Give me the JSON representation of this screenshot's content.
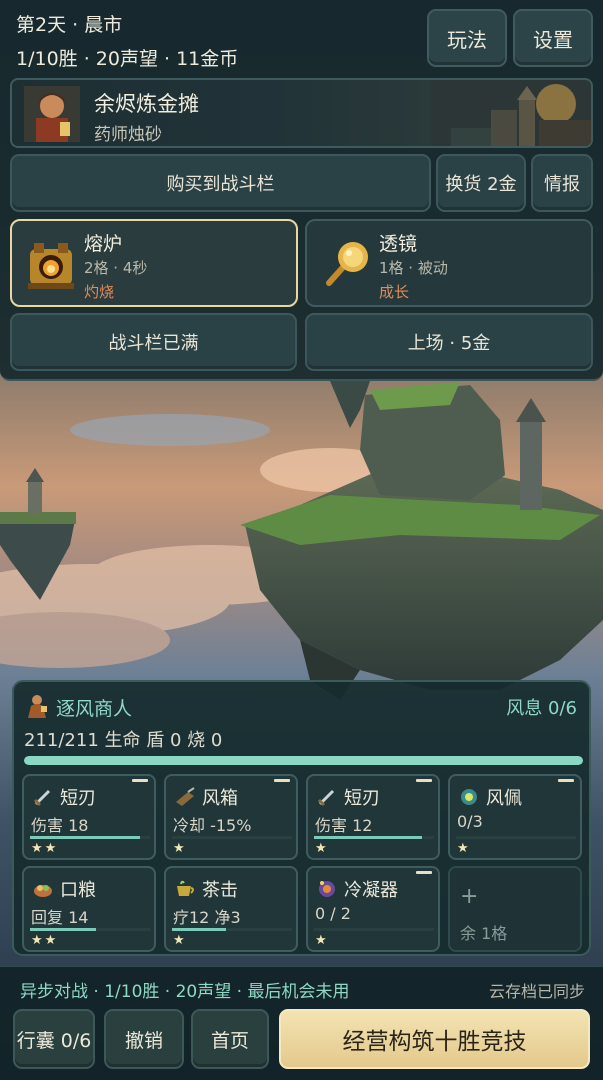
{
  "header": {
    "day_phase": "第2天 · 晨市",
    "progress": "1/10胜 · 20声望 · 11金币",
    "rules_label": "玩法",
    "settings_label": "设置"
  },
  "shop": {
    "name": "余烬炼金摊",
    "owner": "药师烛砂"
  },
  "actions": {
    "buy_label": "购买到战斗栏",
    "reroll_label": "换货 2金",
    "intel_label": "情报",
    "battle_full_label": "战斗栏已满",
    "deploy_label": "上场 · 5金"
  },
  "shop_items": [
    {
      "name": "熔炉",
      "stats": "2格 · 4秒",
      "tag": "灼烧",
      "icon": "furnace-icon",
      "selected": true
    },
    {
      "name": "透镜",
      "stats": "1格 · 被动",
      "tag": "成长",
      "icon": "lens-icon",
      "selected": false
    }
  ],
  "opponent": {
    "name": "逐风商人",
    "wind": "风息 0/6",
    "stats": "211/211 生命  盾 0  烧 0",
    "hp_fraction": 1.0
  },
  "slots": [
    {
      "name": "短刃",
      "stat": "伤害 18",
      "stars": "★★",
      "icon": "dagger-icon",
      "bar": 0.92
    },
    {
      "name": "风箱",
      "stat": "冷却 -15%",
      "stars": "★",
      "icon": "bellows-icon",
      "bar": 0
    },
    {
      "name": "短刃",
      "stat": "伤害 12",
      "stars": "★",
      "icon": "dagger-icon",
      "bar": 0.9
    },
    {
      "name": "风佩",
      "stat": "0/3",
      "stars": "★",
      "icon": "wind-charm-icon",
      "bar": 0
    },
    {
      "name": "口粮",
      "stat": "回复 14",
      "stars": "★★",
      "icon": "rations-icon",
      "bar": 0.55
    },
    {
      "name": "茶击",
      "stat": "疗12 净3",
      "stars": "★",
      "icon": "tea-icon",
      "bar": 0.45
    },
    {
      "name": "冷凝器",
      "stat": "0 / 2",
      "stars": "★",
      "icon": "condenser-icon",
      "bar": 0
    }
  ],
  "empty_slot": {
    "plus": "+",
    "label": "余 1格"
  },
  "footer": {
    "status": "异步对战 · 1/10胜 · 20声望 · 最后机会未用",
    "cloud": "云存档已同步",
    "bag_label": "行囊 0/6",
    "undo_label": "撤销",
    "home_label": "首页",
    "primary_label": "经营构筑十胜竞技"
  },
  "colors": {
    "accent_teal": "#8fd8c4",
    "gold_button": "#e4c98c",
    "tag_orange": "#e08c5c",
    "star": "#f2e6b8"
  }
}
